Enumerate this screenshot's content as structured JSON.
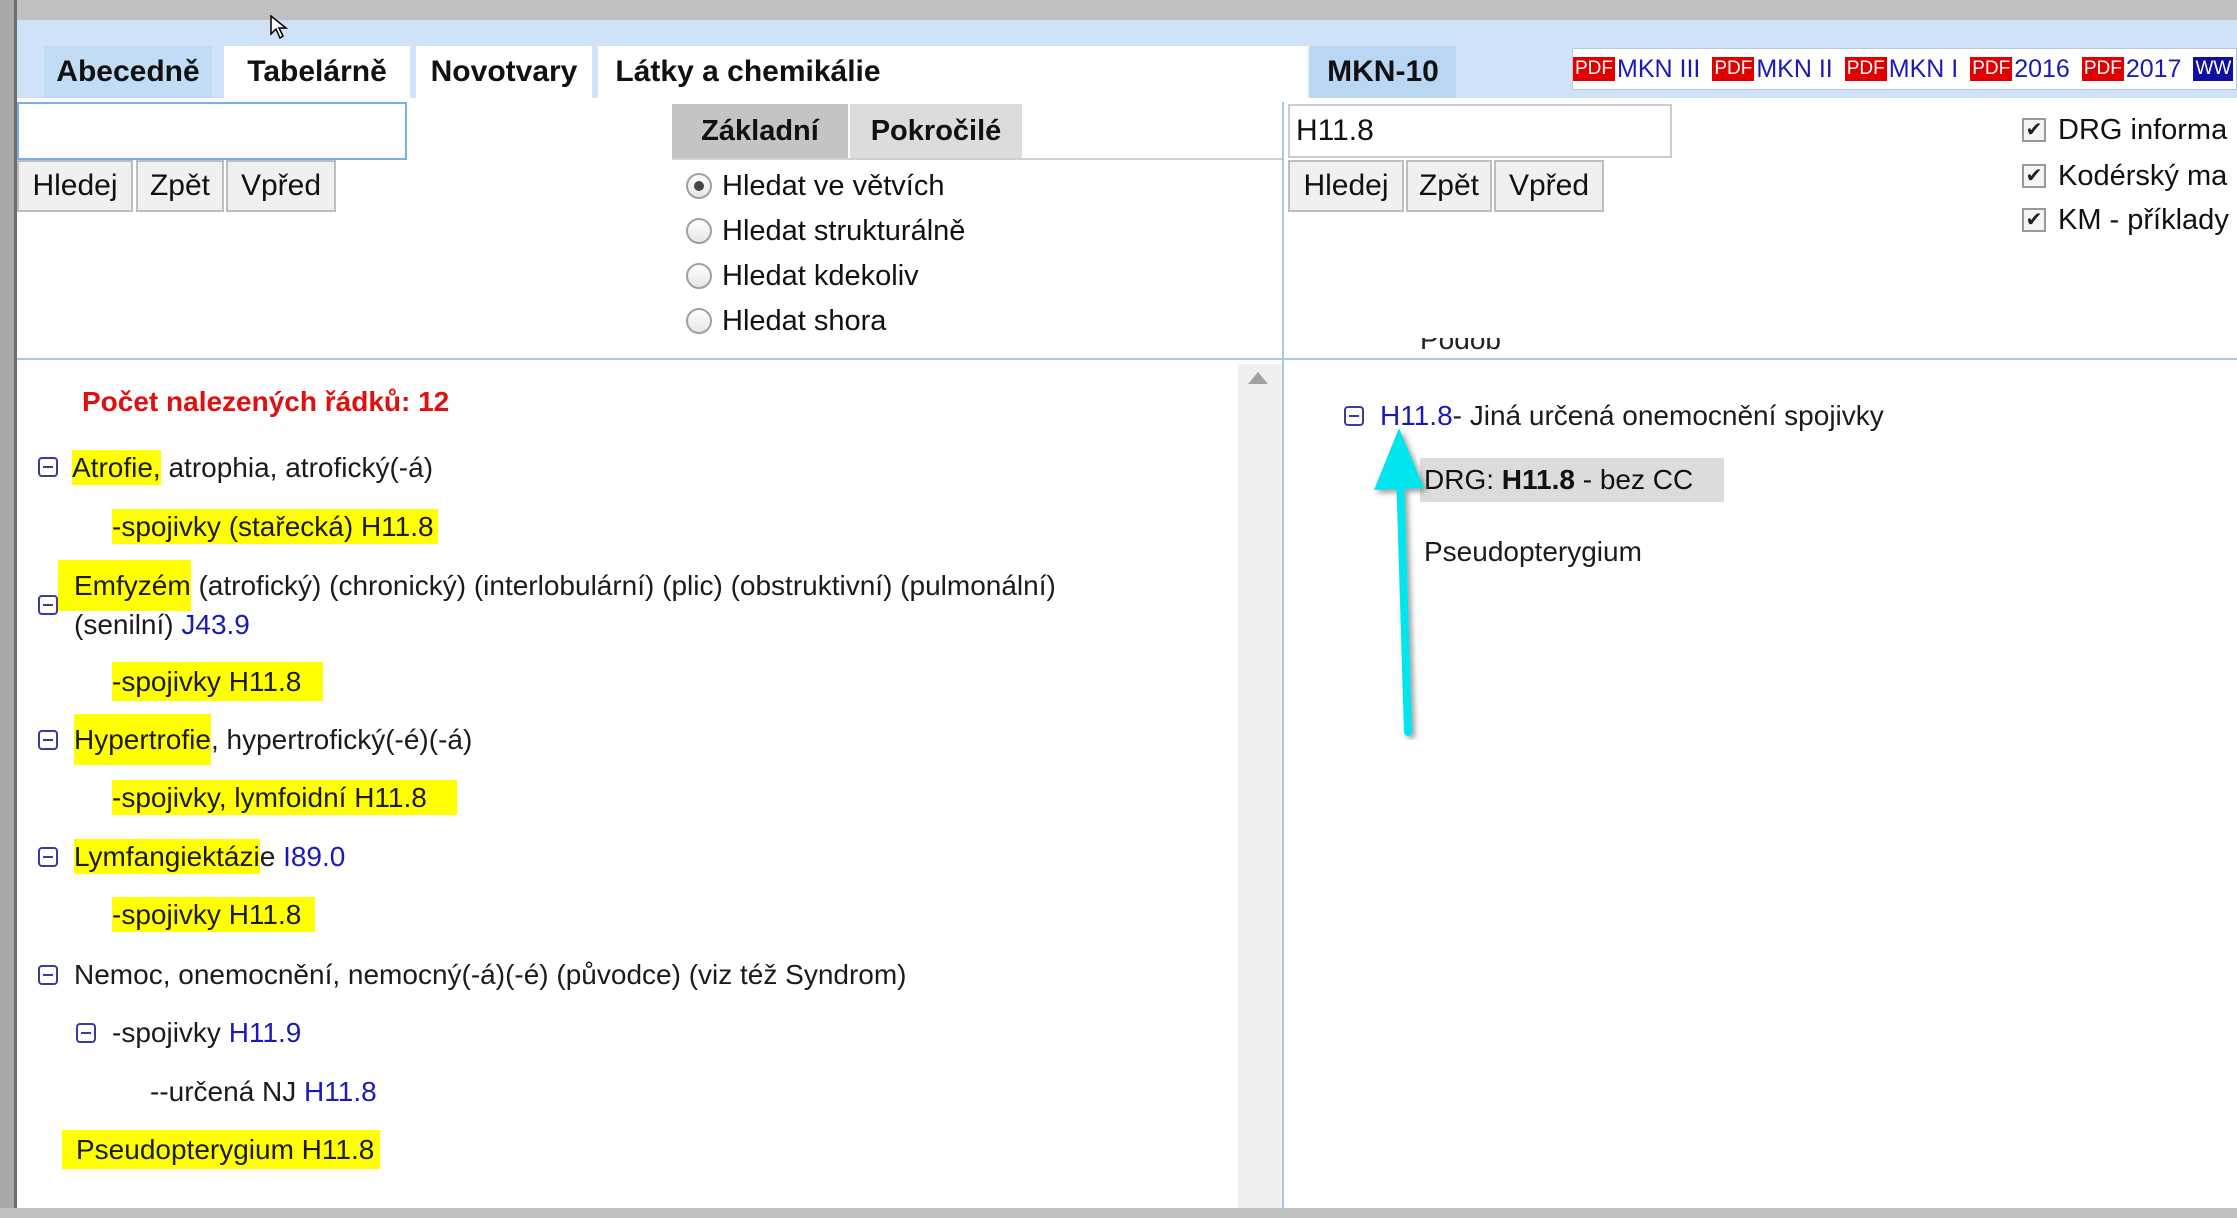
{
  "tabs": {
    "abecedne": "Abecedně",
    "tabelarne": "Tabelárně",
    "novotvary": "Novotvary",
    "latky": "Látky a chemikálie",
    "mkn10": "MKN-10"
  },
  "pdf_links": [
    {
      "icon": "PDF",
      "label": "MKN III"
    },
    {
      "icon": "PDF",
      "label": "MKN II"
    },
    {
      "icon": "PDF",
      "label": "MKN I"
    },
    {
      "icon": "PDF",
      "label": "2016"
    },
    {
      "icon": "PDF",
      "label": "2017"
    }
  ],
  "www_icon": "WW",
  "left_search": {
    "value": "",
    "hledej": "Hledej",
    "zpet": "Zpět",
    "vpred": "Vpřed"
  },
  "modes": {
    "zakladni": "Základní",
    "pokrocile": "Pokročilé"
  },
  "radio_options": [
    {
      "label": "Hledat ve větvích",
      "checked": true
    },
    {
      "label": "Hledat strukturálně",
      "checked": false
    },
    {
      "label": "Hledat kdekoliv",
      "checked": false
    },
    {
      "label": "Hledat shora",
      "checked": false
    }
  ],
  "right_search": {
    "value": "H11.8",
    "hledej": "Hledej",
    "zpet": "Zpět",
    "vpred": "Vpřed"
  },
  "checkboxes": [
    {
      "label": "DRG informa",
      "checked": true
    },
    {
      "label": "Kodérský ma",
      "checked": true
    },
    {
      "label": "KM - příklady",
      "checked": true
    }
  ],
  "results": {
    "count_label": "Počet nalezených řádků: 12",
    "items": {
      "atrofie_hl": "Atrofie,",
      "atrofie_rest": " atrophia, atrofický(-á)",
      "atrofie_sub": "-spojivky (stařecká) H11.8",
      "emfyzem_hl": "Emfyzém",
      "emfyzem_rest": " (atrofický) (chronický) (interlobulární) (plic) (obstruktivní) (pulmonální)",
      "emfyzem_line2": "(senilní) ",
      "emfyzem_code": "J43.9",
      "emfyzem_sub": "-spojivky H11.8",
      "hypertrofie_hl": "Hypertrofie",
      "hypertrofie_rest": ", hypertrofický(-é)(-á)",
      "hypertrofie_sub": "-spojivky, lymfoidní H11.8",
      "lymf_hl": "Lymfangiektázi",
      "lymf_rest": "e ",
      "lymf_code": "I89.0",
      "lymf_sub": "-spojivky H11.8",
      "nemoc": "Nemoc, onemocnění, nemocný(-á)(-é) (původce) (viz též Syndrom)",
      "nemoc_sub": "-spojivky ",
      "nemoc_sub_code": "H11.9",
      "nemoc_subsub": "--určená NJ ",
      "nemoc_subsub_code": "H11.8",
      "pseudo": "Pseudopterygium H11.8"
    }
  },
  "detail": {
    "cut_text": "Podob",
    "code": "H11.8",
    "title": "- Jiná určená onemocnění spojivky",
    "drg_prefix": "DRG: ",
    "drg_code": "H11.8",
    "drg_suffix": " - bez CC",
    "pseudo": "Pseudopterygium"
  },
  "colors": {
    "tab_bar": "#cfe2f7",
    "highlight": "#ffff00",
    "link": "#1a1ab8",
    "count_red": "#e01010",
    "arrow": "#00e5ee"
  },
  "icons": {
    "collapse": "minus-square-icon",
    "arrow_annotation": "cyan-arrow-icon",
    "cursor": "mouse-cursor-icon"
  }
}
